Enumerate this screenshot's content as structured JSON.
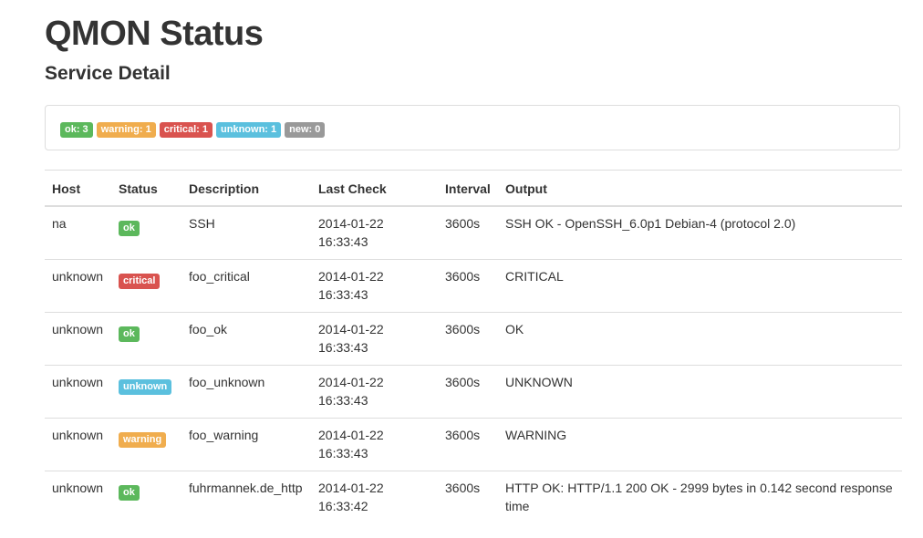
{
  "header": {
    "title": "QMON Status",
    "subtitle": "Service Detail"
  },
  "summary": [
    {
      "label": "ok: 3",
      "variant": "success",
      "color": "#5cb85c"
    },
    {
      "label": "warning: 1",
      "variant": "warning",
      "color": "#f0ad4e"
    },
    {
      "label": "critical: 1",
      "variant": "danger",
      "color": "#d9534f"
    },
    {
      "label": "unknown: 1",
      "variant": "info",
      "color": "#5bc0de"
    },
    {
      "label": "new: 0",
      "variant": "default",
      "color": "#999999"
    }
  ],
  "table": {
    "columns": [
      "Host",
      "Status",
      "Description",
      "Last Check",
      "Interval",
      "Output"
    ],
    "rows": [
      {
        "host": "na",
        "status": "ok",
        "variant": "success",
        "description": "SSH",
        "date": "2014-01-22",
        "time": "16:33:43",
        "interval": "3600s",
        "output": "SSH OK - OpenSSH_6.0p1 Debian-4 (protocol 2.0)"
      },
      {
        "host": "unknown",
        "status": "critical",
        "variant": "danger",
        "description": "foo_critical",
        "date": "2014-01-22",
        "time": "16:33:43",
        "interval": "3600s",
        "output": "CRITICAL"
      },
      {
        "host": "unknown",
        "status": "ok",
        "variant": "success",
        "description": "foo_ok",
        "date": "2014-01-22",
        "time": "16:33:43",
        "interval": "3600s",
        "output": "OK"
      },
      {
        "host": "unknown",
        "status": "unknown",
        "variant": "info",
        "description": "foo_unknown",
        "date": "2014-01-22",
        "time": "16:33:43",
        "interval": "3600s",
        "output": "UNKNOWN"
      },
      {
        "host": "unknown",
        "status": "warning",
        "variant": "warning",
        "description": "foo_warning",
        "date": "2014-01-22",
        "time": "16:33:43",
        "interval": "3600s",
        "output": "WARNING"
      },
      {
        "host": "unknown",
        "status": "ok",
        "variant": "success",
        "description": "fuhrmannek.de_http",
        "date": "2014-01-22",
        "time": "16:33:42",
        "interval": "3600s",
        "output": "HTTP OK: HTTP/1.1 200 OK - 2999 bytes in 0.142 second response time"
      }
    ]
  }
}
